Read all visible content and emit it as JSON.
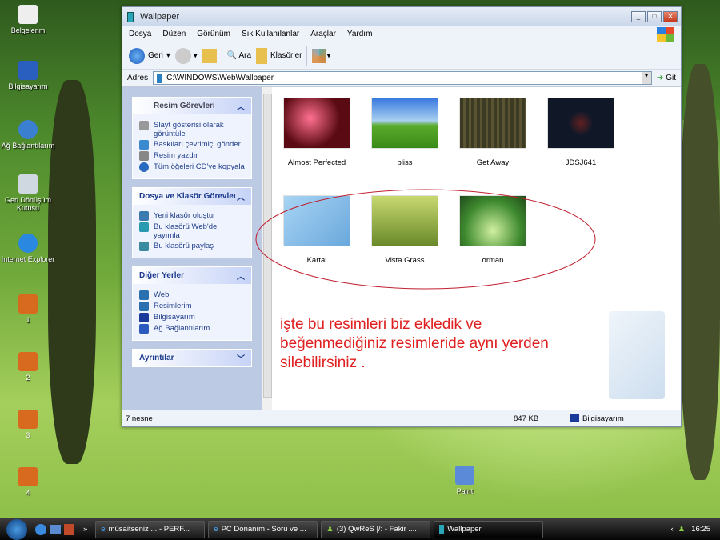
{
  "desktop": {
    "icons": [
      {
        "label": "Belgelerim"
      },
      {
        "label": "Bilgisayarım"
      },
      {
        "label": "Ağ Bağlantılarım"
      },
      {
        "label": "Geri Dönüşüm Kutusu"
      },
      {
        "label": "Internet Explorer"
      },
      {
        "label": "1"
      },
      {
        "label": "2"
      },
      {
        "label": "3"
      },
      {
        "label": "4"
      },
      {
        "label": "Paint"
      }
    ]
  },
  "window": {
    "title": "Wallpaper",
    "menu": [
      "Dosya",
      "Düzen",
      "Görünüm",
      "Sık Kullanılanlar",
      "Araçlar",
      "Yardım"
    ],
    "toolbar": {
      "back": "Geri",
      "search": "Ara",
      "folders": "Klasörler"
    },
    "address": {
      "label": "Adres",
      "value": "C:\\WINDOWS\\Web\\Wallpaper",
      "go": "Git"
    },
    "panels": [
      {
        "title": "Resim Görevleri",
        "items": [
          "Slayt gösterisi olarak görüntüle",
          "Baskıları çevrimiçi gönder",
          "Resim yazdır",
          "Tüm öğeleri CD'ye kopyala"
        ]
      },
      {
        "title": "Dosya ve Klasör Görevleri",
        "items": [
          "Yeni klasör oluştur",
          "Bu klasörü Web'de yayımla",
          "Bu klasörü paylaş"
        ]
      },
      {
        "title": "Diğer Yerler",
        "items": [
          "Web",
          "Resimlerim",
          "Bilgisayarım",
          "Ağ Bağlantılarım"
        ]
      },
      {
        "title": "Ayrıntılar",
        "items": []
      }
    ],
    "files": [
      {
        "name": "Almost Perfected",
        "color": "#5a0a12"
      },
      {
        "name": "bliss",
        "color": "#4a9a2a"
      },
      {
        "name": "Get Away",
        "color": "#3b3a22"
      },
      {
        "name": "JDSJ641",
        "color": "#101828"
      },
      {
        "name": "Kartal",
        "color": "#6aa8dc"
      },
      {
        "name": "Vista Grass",
        "color": "#8aa83a"
      },
      {
        "name": "orman",
        "color": "#3f8a2f"
      }
    ],
    "annotation": [
      "işte bu resimleri biz ekledik ve",
      "beğenmediğiniz resimleride aynı yerden",
      "silebilirsiniz ."
    ],
    "status": {
      "count": "7 nesne",
      "size": "847 KB",
      "location": "Bilgisayarım"
    }
  },
  "taskbar": {
    "items": [
      {
        "label": "müsaitseniz ... - PERF..."
      },
      {
        "label": "PC Donanım - Soru ve ..."
      },
      {
        "label": "(3) QwReS |/: - Fakir ...."
      },
      {
        "label": "Wallpaper"
      }
    ],
    "overflow": "»",
    "clock": "16:25"
  }
}
